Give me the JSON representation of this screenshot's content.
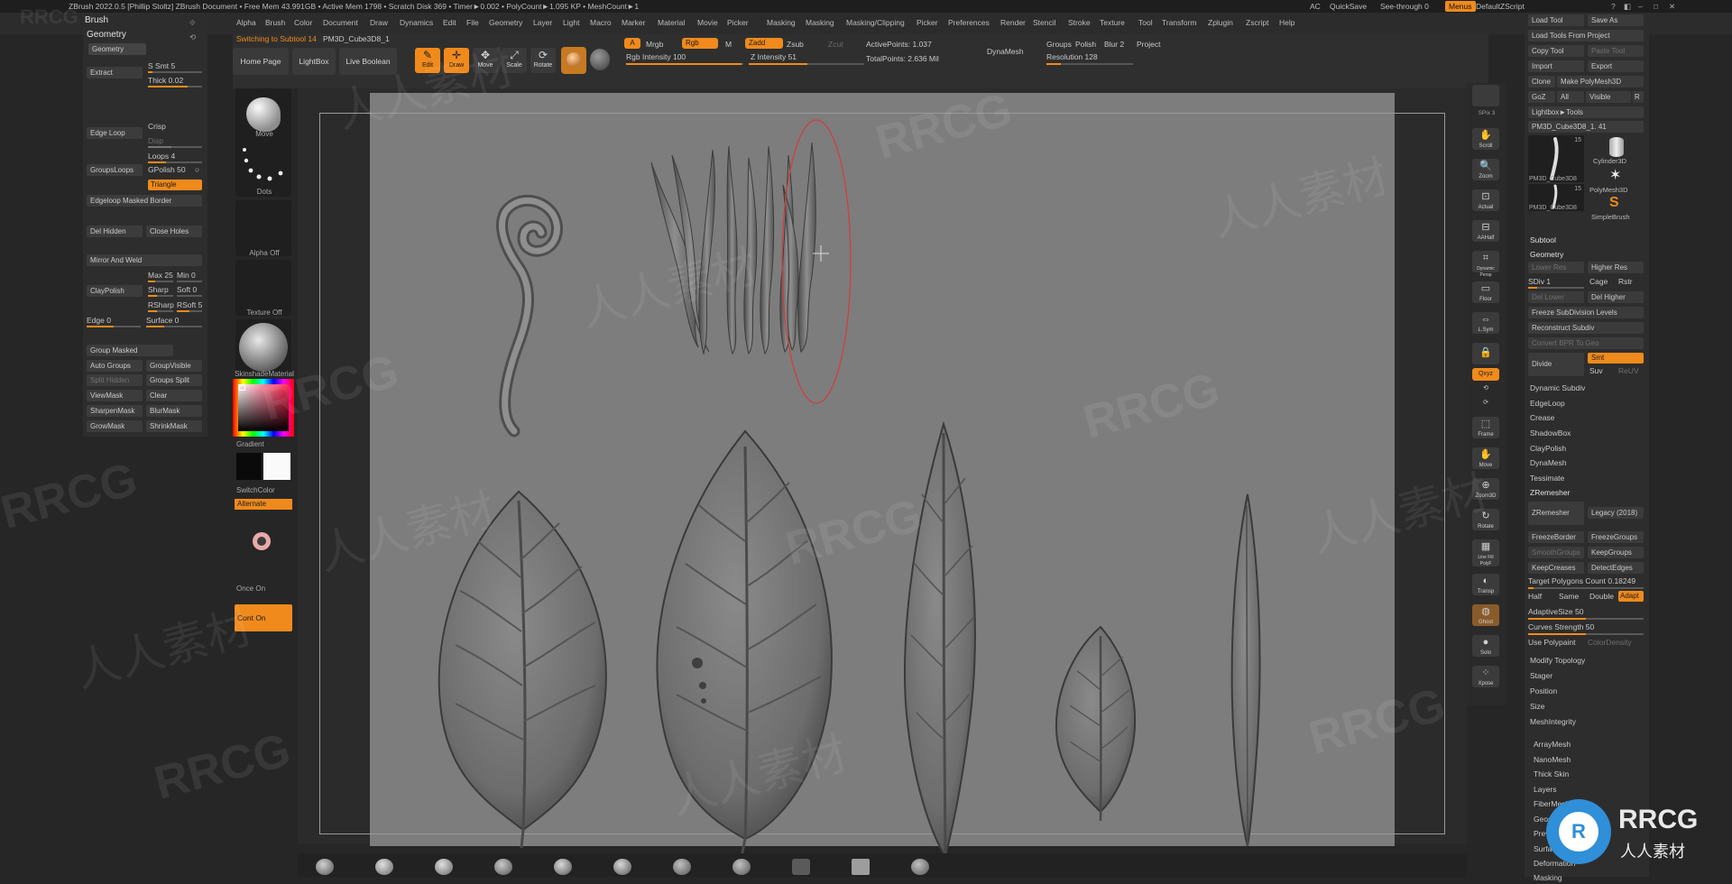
{
  "titlebar": {
    "text": "ZBrush 2022.0.5 [Phillip Stoltz]  ZBrush Document    • Free Mem 43.991GB • Active Mem 1798 • Scratch Disk 369 • Timer►0.002 • PolyCount►1.095 KP • MeshCount►1",
    "ac": "AC",
    "quicksave": "QuickSave",
    "see_through": "See-through  0",
    "menus": "Menus",
    "script": "DefaultZScript"
  },
  "menus": [
    "Alpha",
    "Brush",
    "Color",
    "Document",
    "Draw",
    "Dynamics",
    "Edit",
    "File",
    "Geometry",
    "Layer",
    "Light",
    "Macro",
    "Marker",
    "Material",
    "Movie",
    "Picker",
    "Masking",
    "Masking",
    "Masking/Clipping",
    "Picker",
    "Preferences",
    "Render",
    "Stencil",
    "Stroke",
    "Texture",
    "Tool",
    "Transform",
    "Zplugin",
    "Zscript",
    "Help"
  ],
  "shelf": {
    "notice": "Switching to Subtool 14",
    "subtool_name": "PM3D_Cube3D8_1",
    "home_page": "Home Page",
    "lightbox": "LightBox",
    "live_boolean": "Live Boolean",
    "edit": "Edit",
    "draw": "Draw",
    "move": "Move",
    "scale": "Scale",
    "rotate": "Rotate",
    "a": "A",
    "mrgb": "Mrgb",
    "rgb": "Rgb",
    "m": "M",
    "rgb_intensity": "Rgb Intensity 100",
    "zadd": "Zadd",
    "zsub": "Zsub",
    "zcut": "Zcut",
    "z_intensity": "Z Intensity 51",
    "active_points": "ActivePoints: 1.037",
    "total_points": "TotalPoints: 2.636 Mil",
    "dynamesh": "DynaMesh",
    "groups": "Groups",
    "polish": "Polish",
    "blur": "Blur 2",
    "project": "Project",
    "resolution": "Resolution 128"
  },
  "left_palette": {
    "header": "Brush",
    "section": "Geometry",
    "subsection": "Geometry",
    "extract": "Extract",
    "s_smt": "S Smt 5",
    "thick": "Thick 0.02",
    "edge_loop": "Edge Loop",
    "crisp": "Crisp",
    "disp": "Disp",
    "loops": "Loops 4",
    "groups_loops": "GroupsLoops",
    "gpolish": "GPolish 50",
    "triangle": "Triangle",
    "edgeloop_masked_border": "Edgeloop Masked Border",
    "del_hidden": "Del Hidden",
    "close_holes": "Close Holes",
    "mirror_and_weld": "Mirror And Weld",
    "max": "Max 25",
    "min": "Min 0",
    "claypolish": "ClayPolish",
    "sharp": "Sharp",
    "soft": "Soft 0",
    "rsharp": "RSharp",
    "rsoft": "RSoft 5",
    "edge": "Edge 0",
    "surface": "Surface 0",
    "group_masked": "Group Masked",
    "auto_groups": "Auto Groups",
    "groups_visible": "GroupVisible",
    "split_hidden": "Split Hidden",
    "groups_split": "Groups Split",
    "viewmask": "ViewMask",
    "clear": "Clear",
    "sharpenmask": "SharpenMask",
    "blurmask": "BlurMask",
    "growmask": "GrowMask",
    "shrinkmask": "ShrinkMask"
  },
  "brush_column": {
    "move": "Move",
    "dots": "Dots",
    "alpha_off": "Alpha Off",
    "texture_off": "Texture Off",
    "material": "SkinshadeMaterial",
    "gradient": "Gradient",
    "switch_color": "SwitchColor",
    "alternate": "Alternate",
    "once_on": "Once On",
    "cont_on": "Cont On"
  },
  "right_dock": [
    "SPix 3",
    "Scroll",
    "Zoom",
    "Actual",
    "AAHalf",
    "Dynamic Persp",
    "Floor",
    "L.Sym",
    "",
    "Qxyz",
    "",
    "",
    "Frame",
    "Move",
    "Zoom3D",
    "Rotate",
    "Line Fill PolyF",
    "Transp",
    "Ghost",
    "Solo",
    "Xpose"
  ],
  "right_palette": {
    "load_tool": "Load Tool",
    "save_as": "Save As",
    "load_tools_from_project": "Load Tools From Project",
    "copy_tool": "Copy Tool",
    "paste_tool": "Paste Tool",
    "import": "Import",
    "export": "Export",
    "clone": "Clone",
    "make_polymesh": "Make PolyMesh3D",
    "goz": "GoZ",
    "all": "All",
    "visible": "Visible",
    "r": "R",
    "lightbox_tools": "Lightbox►Tools",
    "current_tool": "PM3D_Cube3D8_1. 41",
    "tool_count_1": "15",
    "tool_count_2": "15",
    "tool_name_1": "PM3D_Cube3D8",
    "tool_name_2": "PM3D_Cube3D8",
    "cylinder": "Cylinder3D",
    "polymesh": "PolyMesh3D",
    "simplebrush": "SimpleBrush",
    "subtool": "Subtool",
    "geometry": "Geometry",
    "lower_res": "Lower Res",
    "higher_res": "Higher Res",
    "sdiv": "SDiv 1",
    "cage": "Cage",
    "rstr": "Rstr",
    "del_lower": "Del Lower",
    "del_higher": "Del Higher",
    "freeze_subdiv": "Freeze SubDivision Levels",
    "reconstruct_subdiv": "Reconstruct Subdiv",
    "convert_bpr": "Convert BPR To Geo",
    "divide": "Divide",
    "smt": "Smt",
    "suv": "Suv",
    "reuv": "ReUV",
    "dynamic_subdiv": "Dynamic Subdiv",
    "edgeloop": "EdgeLoop",
    "crease": "Crease",
    "shadowbox": "ShadowBox",
    "claypolish": "ClayPolish",
    "dynamesh": "DynaMesh",
    "tessimate": "Tessimate",
    "zremesher_header": "ZRemesher",
    "zremesher": "ZRemesher",
    "legacy": "Legacy (2018)",
    "freeze_border": "FreezeBorder",
    "freeze_groups": "FreezeGroups",
    "smooth_groups": "SmoothGroups",
    "keep_groups": "KeepGroups",
    "keep_creases": "KeepCreases",
    "detect_edges": "DetectEdges",
    "target_polycount": "Target Polygons Count 0.18249",
    "half": "Half",
    "same": "Same",
    "double": "Double",
    "adapt": "Adapt",
    "adaptive_size": "AdaptiveSize 50",
    "curves_strength": "Curves Strength 50",
    "use_polypaint": "Use Polypaint",
    "color_density": "ColorDensity",
    "modify_topology": "Modify Topology",
    "stager": "Stager",
    "position": "Position",
    "size": "Size",
    "mesh_integrity": "MeshIntegrity",
    "arraymesh": "ArrayMesh",
    "nanomesh": "NanoMesh",
    "thick_skin": "Thick Skin",
    "layers": "Layers",
    "fibermesh": "FiberMesh",
    "geometry_hd": "Geometry HD",
    "preview": "Preview",
    "surface": "Surface",
    "deformation": "Deformation",
    "masking": "Masking"
  },
  "watermarks": {
    "latin": "RRCG",
    "cn": "人人素材",
    "logo_text": "RRCG",
    "logo_sub": "人人素材"
  },
  "colors": {
    "accent": "#f08a1c",
    "doc_bg": "#7d7d7d",
    "panel": "#2d2d2d"
  }
}
